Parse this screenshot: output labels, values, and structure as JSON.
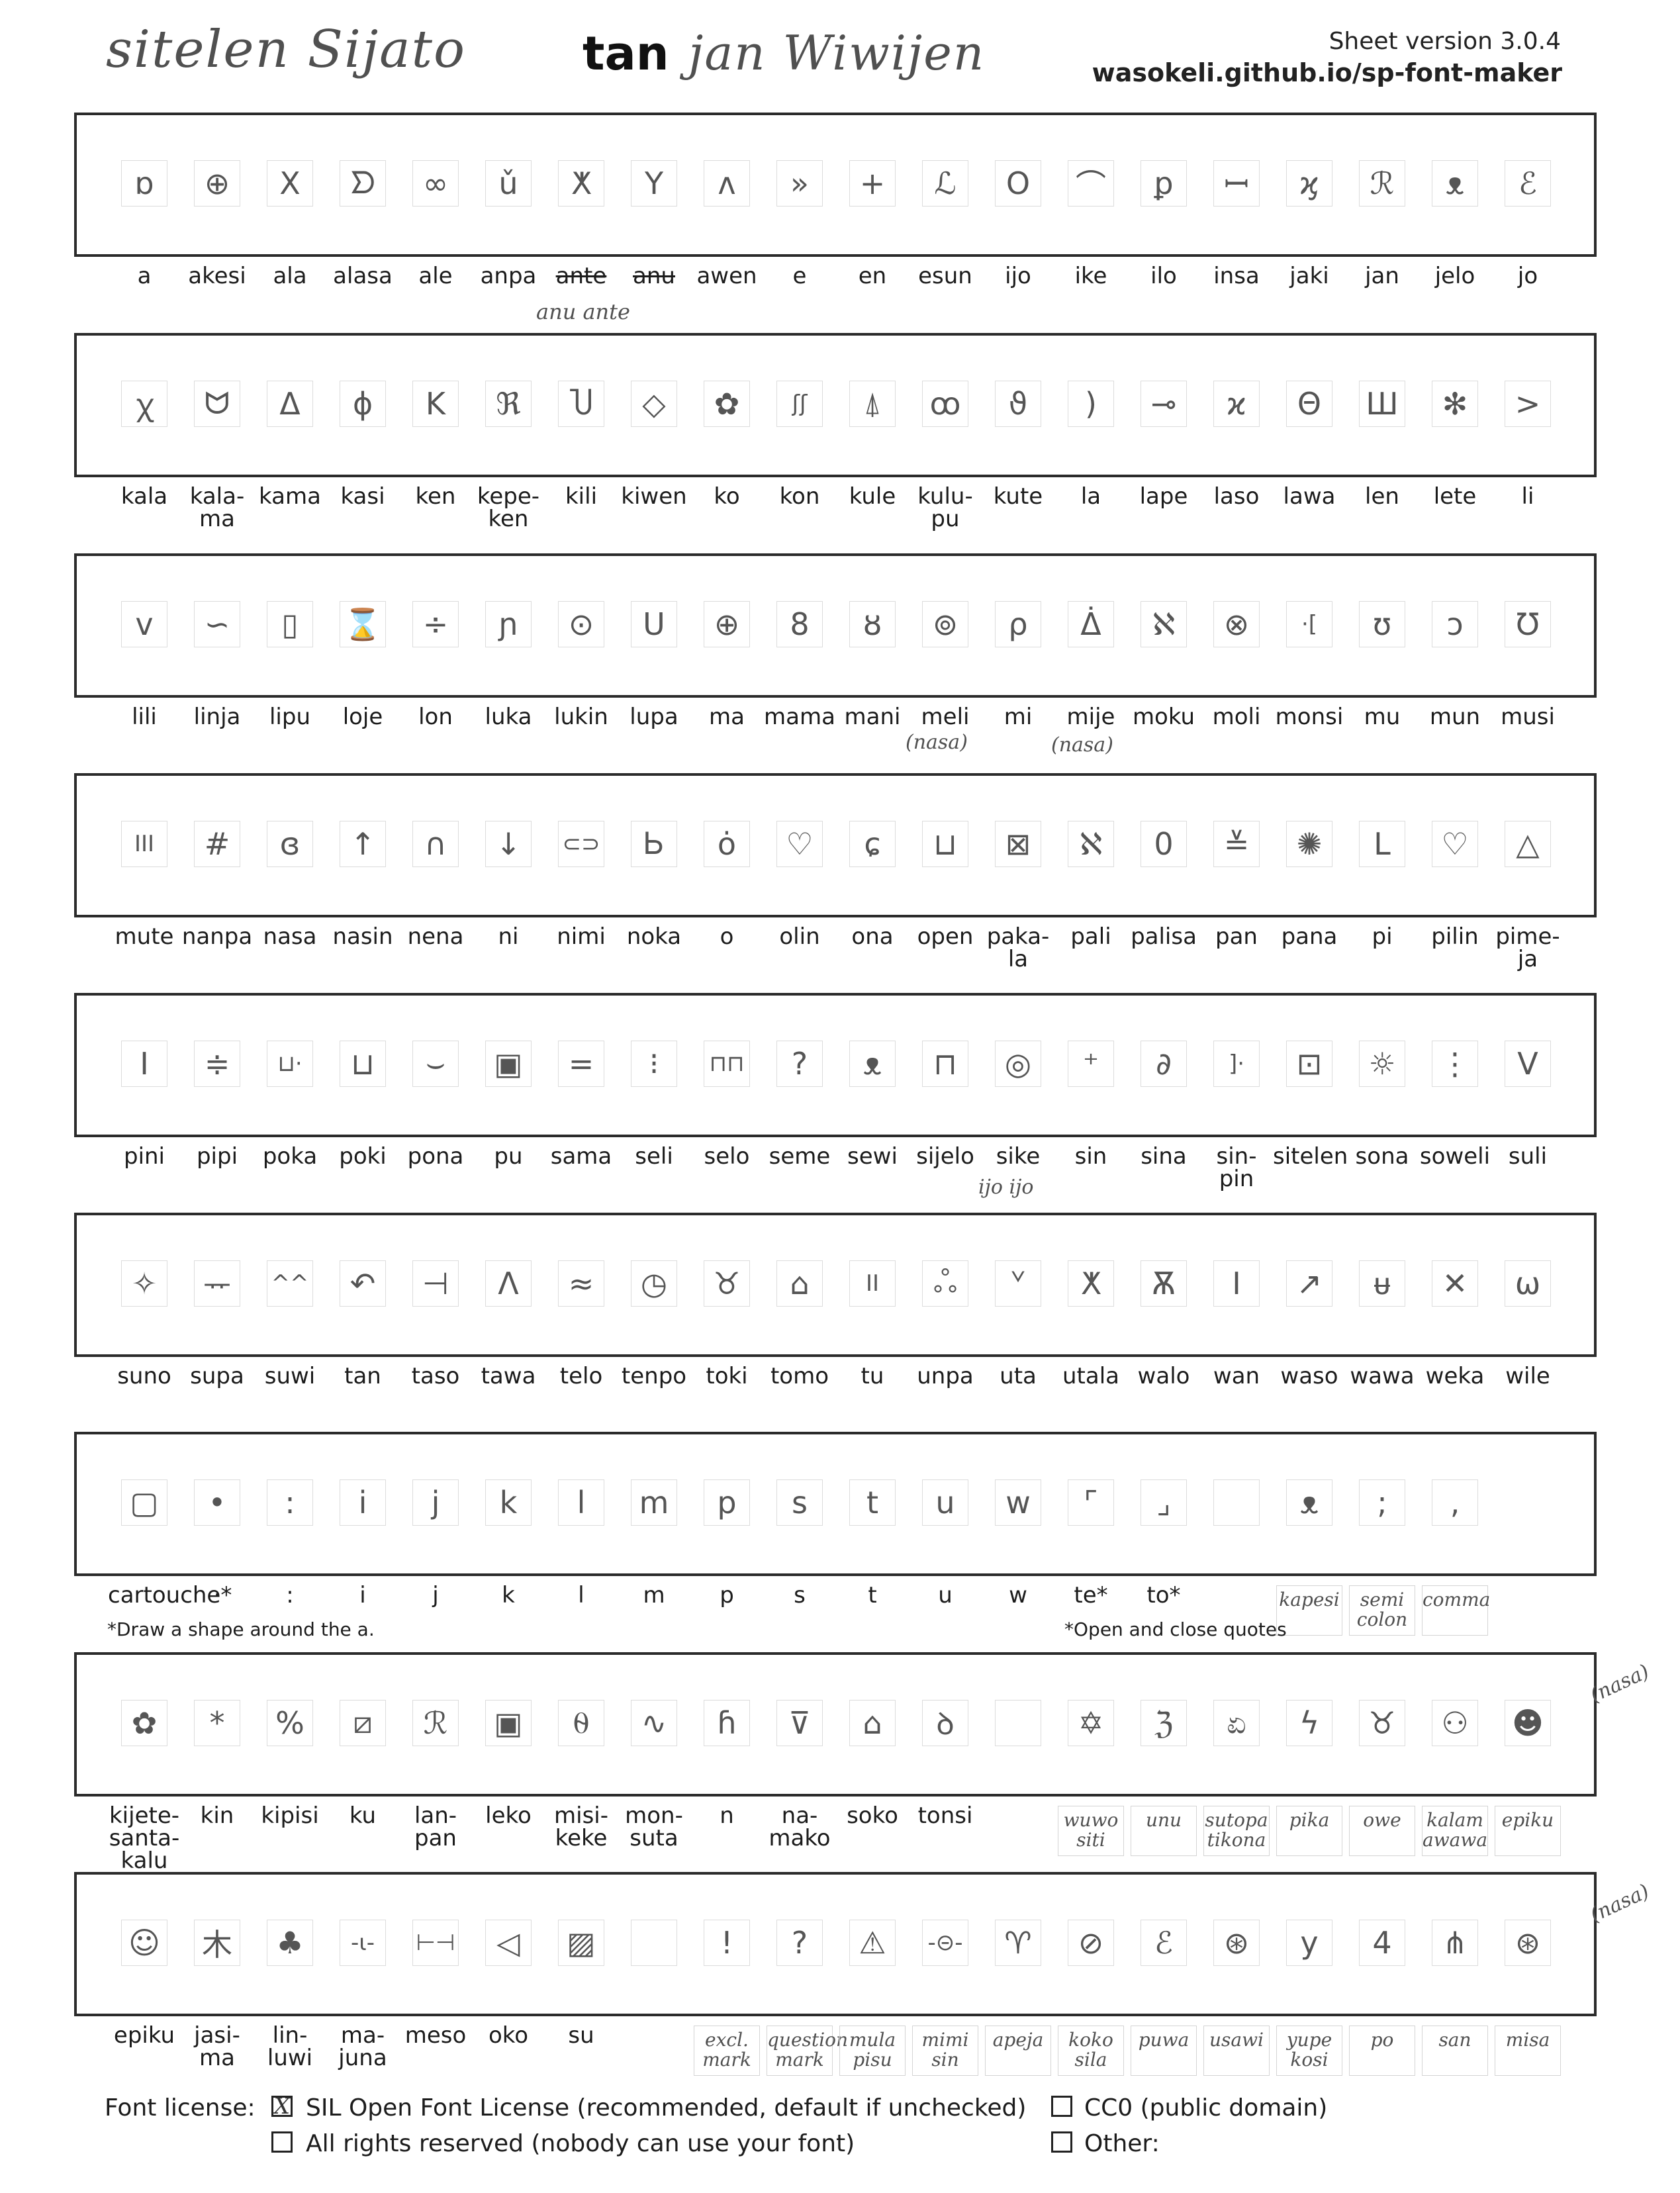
{
  "header": {
    "font_name": "sitelen Sijato",
    "maker_prefix": "tan",
    "maker_name": "jan Wiwijen",
    "version": "Sheet version 3.0.4",
    "url": "wasokeli.github.io/sp-font-maker"
  },
  "rows": [
    {
      "glyphs": [
        "ɒ",
        "⊕",
        "X",
        "ᗤ",
        "∞",
        "ǔ",
        "ⵅ",
        "Y",
        "ʌ",
        "»",
        "+",
        "ℒ",
        "O",
        "⌒",
        "ꝑ",
        "ꟷ",
        "ϗ",
        "ℛ",
        "ᴥ",
        "ℰ"
      ],
      "labels": [
        "a",
        "akesi",
        "ala",
        "alasa",
        "ale",
        "anpa",
        "ante",
        "anu",
        "awen",
        "e",
        "en",
        "esun",
        "ijo",
        "ike",
        "ilo",
        "insa",
        "jaki",
        "jan",
        "jelo",
        "jo"
      ]
    },
    {
      "glyphs": [
        "ꭓ",
        "ᗢ",
        "Δ",
        "ϕ",
        "K",
        "ℜ",
        "Ⴎ",
        "◇",
        "✿",
        "ʃʃ",
        "⍋",
        "ꝏ",
        "ϑ",
        ")",
        "⊸",
        "ϰ",
        "Θ",
        "Ш",
        "✻",
        ">"
      ],
      "labels": [
        "kala",
        "kala-\nma",
        "kama",
        "kasi",
        "ken",
        "kepe-\nken",
        "kili",
        "kiwen",
        "ko",
        "kon",
        "kule",
        "kulu-\npu",
        "kute",
        "la",
        "lape",
        "laso",
        "lawa",
        "len",
        "lete",
        "li"
      ]
    },
    {
      "glyphs": [
        "v",
        "∽",
        "▯",
        "⌛",
        "÷",
        "ɲ",
        "⊙",
        "U",
        "⊕",
        "8",
        "ȣ",
        "⊚",
        "ρ",
        "ᐄ",
        "ℵ",
        "⊗",
        "·[",
        "ʊ",
        "ↄ",
        "Ʊ"
      ],
      "labels": [
        "lili",
        "linja",
        "lipu",
        "loje",
        "lon",
        "luka",
        "lukin",
        "lupa",
        "ma",
        "mama",
        "mani",
        "meli",
        "mi",
        "mije",
        "moku",
        "moli",
        "monsi",
        "mu",
        "mun",
        "musi"
      ]
    },
    {
      "glyphs": [
        "III",
        "#",
        "ɞ",
        "↑",
        "∩",
        "↓",
        "⊂⊃",
        "Ꮟ",
        "ȯ",
        "♡",
        "ɕ",
        "⊔",
        "⊠",
        "ℵ",
        "0",
        "≚",
        "✺",
        "L",
        "♡",
        "△"
      ],
      "labels": [
        "mute",
        "nanpa",
        "nasa",
        "nasin",
        "nena",
        "ni",
        "nimi",
        "noka",
        "o",
        "olin",
        "ona",
        "open",
        "paka-\nla",
        "pali",
        "palisa",
        "pan",
        "pana",
        "pi",
        "pilin",
        "pime-\nja"
      ]
    },
    {
      "glyphs": [
        "I",
        "≑",
        "⊔·",
        "⊔",
        "⌣",
        "▣",
        "=",
        "⁝",
        "⊓⊓",
        "?",
        "ᴥ",
        "⊓",
        "◎",
        "⁺",
        "∂",
        "]·",
        "⊡",
        "☼",
        "⋮",
        "V"
      ],
      "labels": [
        "pini",
        "pipi",
        "poka",
        "poki",
        "pona",
        "pu",
        "sama",
        "seli",
        "selo",
        "seme",
        "sewi",
        "sijelo",
        "sike",
        "sin",
        "sina",
        "sin-\npin",
        "sitelen",
        "sona",
        "soweli",
        "suli"
      ]
    },
    {
      "glyphs": [
        "✧",
        "ᅲ",
        "^^",
        "↶",
        "⊣",
        "Λ",
        "≈",
        "◷",
        "♉",
        "⌂",
        "II",
        "ஃ",
        "ᘁ",
        "ⵅ",
        "Ѫ",
        "I",
        "↗",
        "ᵾ",
        "✕",
        "ω"
      ],
      "labels": [
        "suno",
        "supa",
        "suwi",
        "tan",
        "taso",
        "tawa",
        "telo",
        "tenpo",
        "toki",
        "tomo",
        "tu",
        "unpa",
        "uta",
        "utala",
        "walo",
        "wan",
        "waso",
        "wawa",
        "weka",
        "wile"
      ]
    },
    {
      "glyphs": [
        "▢",
        "•",
        ":",
        "i",
        "j",
        "k",
        "l",
        "m",
        "p",
        "s",
        "t",
        "u",
        "w",
        "⌜",
        "⌟",
        "",
        "ᴥ",
        ";",
        ","
      ],
      "labels": [
        "cartouche*",
        "·",
        ":",
        "i",
        "j",
        "k",
        "l",
        "m",
        "p",
        "s",
        "t",
        "u",
        "w",
        "te*",
        "to*"
      ],
      "notes": [
        "*Draw a shape around the a.",
        "*Open and close quotes"
      ],
      "hw_labels": [
        "kapesi",
        "semi\ncolon",
        "comma"
      ]
    },
    {
      "glyphs": [
        "✿",
        "*",
        "%",
        "⧄",
        "ℛ",
        "▣",
        "⍬",
        "∿",
        "ɦ",
        "⊽",
        "⌂",
        "ꝺ",
        "",
        "✡",
        "ℨ",
        "ಏ",
        "ϟ",
        "♉",
        "⚇",
        "☻"
      ],
      "labels": [
        "kijete-\nsanta-\nkalu",
        "kin",
        "kipisi",
        "ku",
        "lan-\npan",
        "leko",
        "misi-\nkeke",
        "mon-\nsuta",
        "n",
        "na-\nmako",
        "soko",
        "tonsi"
      ],
      "hw_labels": [
        "wuwo\nsiti",
        "unu",
        "sutopa\ntikona",
        "pika",
        "owe",
        "kalam\nawawa",
        "epiku"
      ],
      "side_note": "(nasa)"
    },
    {
      "glyphs": [
        "☺",
        "木",
        "♣",
        "-ι-",
        "⊢⊣",
        "◁",
        "▨",
        "",
        "!",
        "?",
        "⚠",
        "-⊝-",
        "♈",
        "⊘",
        "ℰ",
        "⊛",
        "y",
        "4",
        "⋔",
        "⊛"
      ],
      "labels": [
        "epiku",
        "jasi-\nma",
        "lin-\nluwi",
        "ma-\njuna",
        "meso",
        "oko",
        "su"
      ],
      "hw_labels": [
        "excl.\nmark",
        "question\nmark",
        "mula\npisu",
        "mimi\nsin",
        "apeja",
        "koko\nsila",
        "puwa",
        "usawi",
        "yupe\nkosi",
        "po",
        "san",
        "misa"
      ],
      "side_note": "(nasa)"
    }
  ],
  "annotations": {
    "row1_correction": "anu ante",
    "meli_note": "(nasa)",
    "mije_note": "(nasa)",
    "sike_note": "ijo ijo"
  },
  "footer": {
    "license_label": "Font license:",
    "ofl": "SIL Open Font License (recommended, default if unchecked)",
    "ofl_checked": "X",
    "all_rights": "All rights reserved (nobody can use your font)",
    "cc0": "CC0 (public domain)",
    "other": "Other:"
  }
}
